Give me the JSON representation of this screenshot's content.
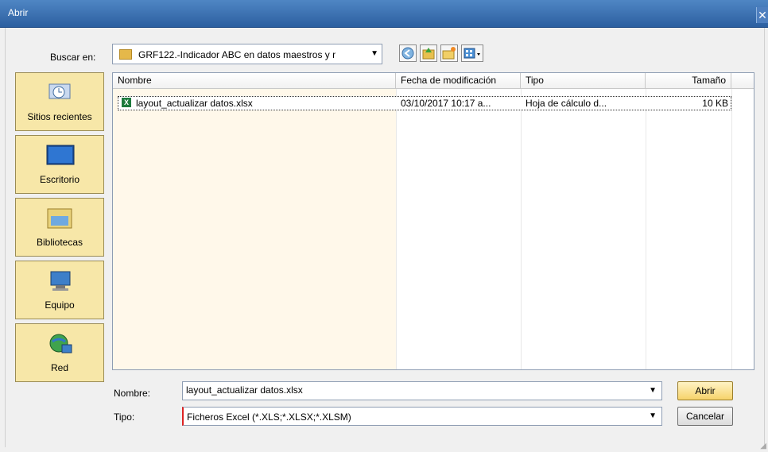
{
  "window": {
    "title": "Abrir",
    "close_symbol": "✕"
  },
  "lookin": {
    "label": "Buscar en:",
    "value": "GRF122.-Indicador ABC en datos maestros y r",
    "arrow": "▼"
  },
  "toolbar": {
    "back": "◀",
    "up": "⬆",
    "newfolder": "✦",
    "views": "▦"
  },
  "places": [
    {
      "label": "Sitios recientes"
    },
    {
      "label": "Escritorio"
    },
    {
      "label": "Bibliotecas"
    },
    {
      "label": "Equipo"
    },
    {
      "label": "Red"
    }
  ],
  "columns": {
    "name": "Nombre",
    "date": "Fecha de modificación",
    "type": "Tipo",
    "size": "Tamaño"
  },
  "files": [
    {
      "icon": "X",
      "name": "layout_actualizar datos.xlsx",
      "date": "03/10/2017 10:17 a...",
      "type": "Hoja de cálculo d...",
      "size": "10 KB"
    }
  ],
  "filename": {
    "label": "Nombre:",
    "value": "layout_actualizar datos.xlsx",
    "arrow": "▼"
  },
  "filetype": {
    "label": "Tipo:",
    "value": "Ficheros Excel (*.XLS;*.XLSX;*.XLSM)",
    "arrow": "▼"
  },
  "buttons": {
    "open": "Abrir",
    "cancel": "Cancelar"
  }
}
